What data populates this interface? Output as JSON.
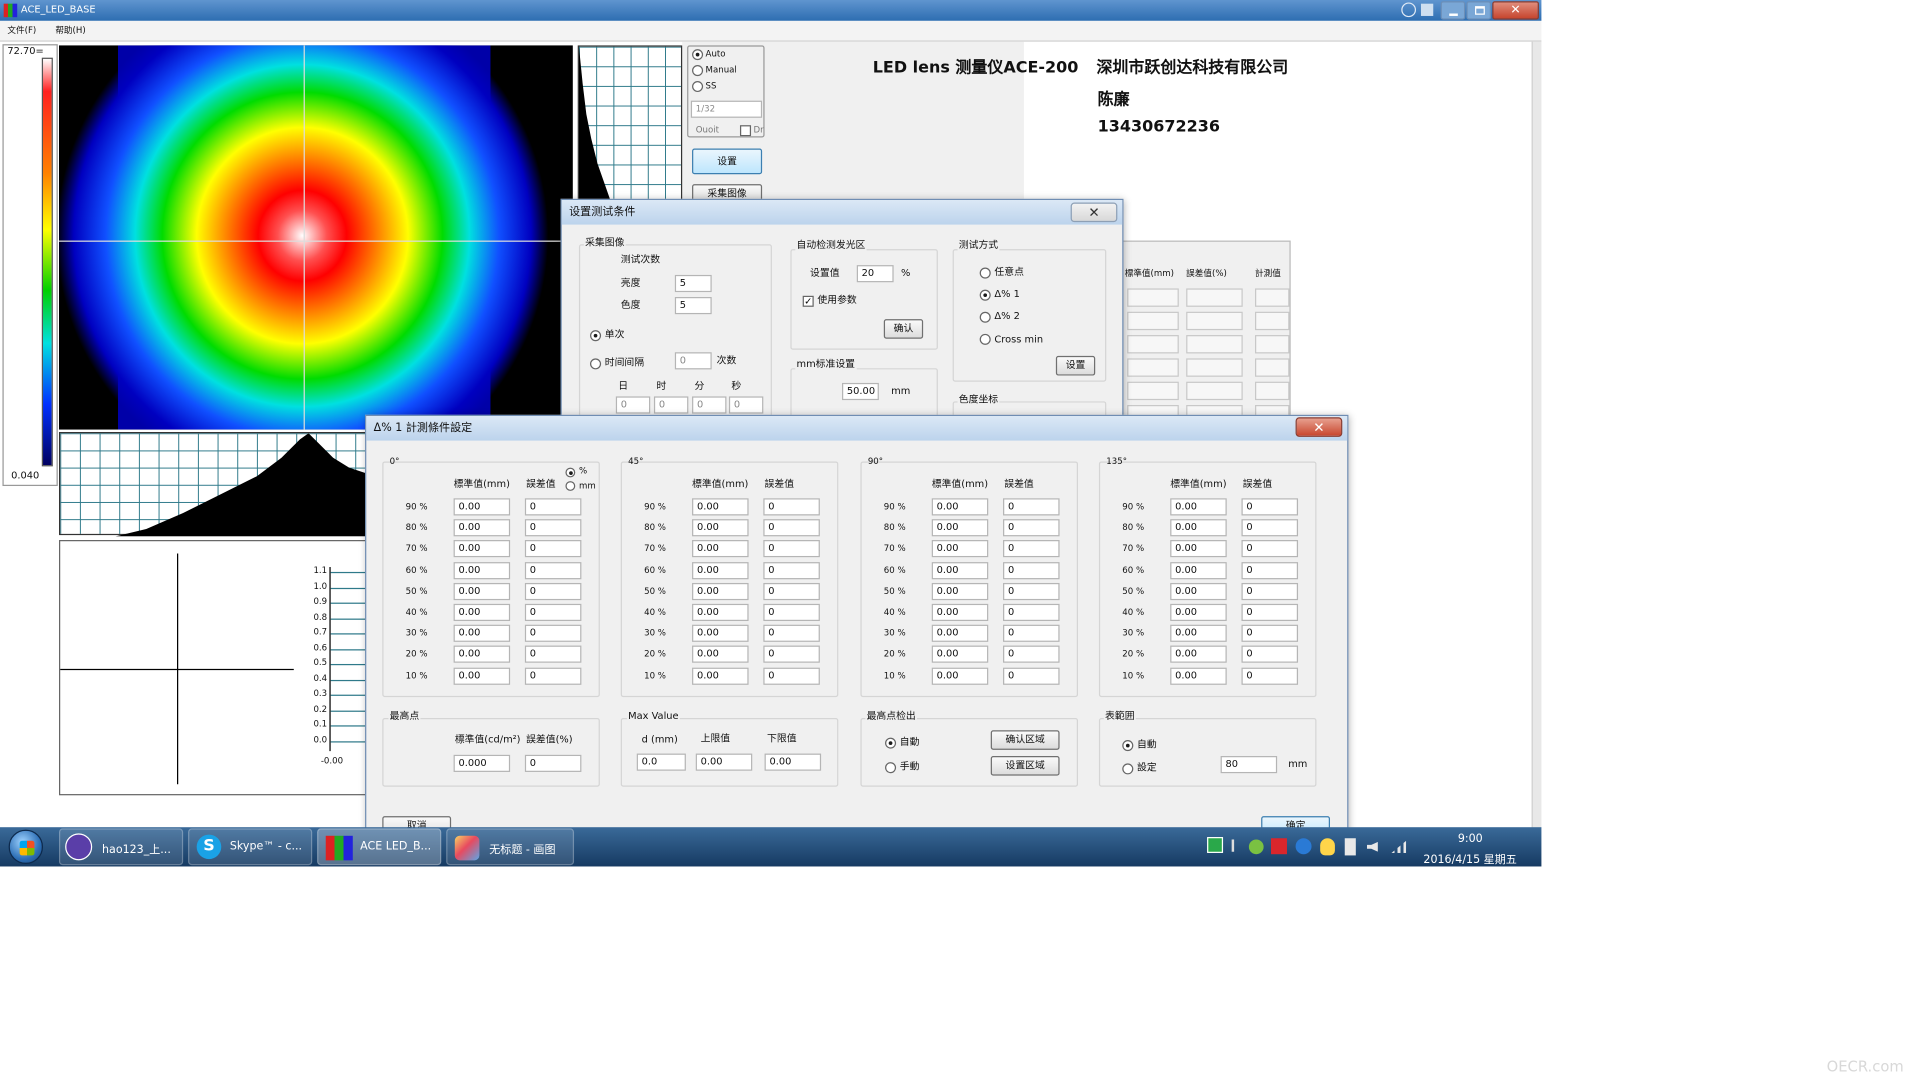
{
  "app": {
    "title": "ACE_LED_BASE",
    "menu": [
      "文件(F)",
      "帮助(H)"
    ]
  },
  "colorbar": {
    "max": "72.70=",
    "min": "0.040"
  },
  "lower_chart": {
    "ticks": [
      "1.1",
      "1.0",
      "0.9",
      "0.8",
      "0.7",
      "0.6",
      "0.5",
      "0.4",
      "0.3",
      "0.2",
      "0.1",
      "0.0",
      "-0.00"
    ]
  },
  "mode": {
    "options": [
      "Auto",
      "Manual",
      "SS"
    ],
    "selected": "Auto",
    "exposure": "1/32",
    "check_label": "Dr",
    "unit": "Ouoit",
    "settings_button": "设置",
    "capture_button": "采集图像"
  },
  "overlay": {
    "line1": "LED lens 测量仪ACE-200",
    "company": "深圳市跃创达科技有限公司",
    "contact": "陈廉",
    "phone": "13430672236"
  },
  "bg_table": {
    "headers": [
      "標準值(mm)",
      "誤差值(%)",
      "計測值"
    ]
  },
  "test_dialog": {
    "title": "设置测试条件",
    "capture": {
      "group": "采集图像",
      "count_label": "测试次数",
      "brightness_label": "亮度",
      "brightness": "5",
      "color_label": "色度",
      "color": "5",
      "single": "单次",
      "interval": "时间间隔",
      "interval_value": "0",
      "times": "次数",
      "units": [
        "日",
        "时",
        "分",
        "秒"
      ],
      "unit_values": [
        "0",
        "0",
        "0",
        "0"
      ]
    },
    "auto": {
      "group": "自动检测发光区",
      "set_label": "设置值",
      "set_value": "20",
      "pct": "%",
      "use_params": "使用参数",
      "confirm": "确认"
    },
    "mm": {
      "group": "mm标准设置",
      "value": "50.00",
      "unit": "mm"
    },
    "method": {
      "group": "测试方式",
      "options": [
        "任意点",
        "Δ% 1",
        "Δ% 2",
        "Cross min"
      ],
      "selected": "Δ% 1",
      "set_button": "设置"
    },
    "coord": {
      "group": "色度坐标"
    }
  },
  "delta_dialog": {
    "title": "Δ% 1 計測條件設定",
    "pct_levels": [
      "90 %",
      "80 %",
      "70 %",
      "60 %",
      "50 %",
      "40 %",
      "30 %",
      "20 %",
      "10 %"
    ],
    "unit_options": [
      "%",
      "mm"
    ],
    "unit_selected": "%",
    "panels": [
      {
        "angle": "0°",
        "std_header": "標準值(mm)",
        "err_header": "誤差值",
        "std": [
          "0.00",
          "0.00",
          "0.00",
          "0.00",
          "0.00",
          "0.00",
          "0.00",
          "0.00",
          "0.00"
        ],
        "err": [
          "0",
          "0",
          "0",
          "0",
          "0",
          "0",
          "0",
          "0",
          "0"
        ]
      },
      {
        "angle": "45°",
        "std_header": "標準值(mm)",
        "err_header": "誤差值",
        "std": [
          "0.00",
          "0.00",
          "0.00",
          "0.00",
          "0.00",
          "0.00",
          "0.00",
          "0.00",
          "0.00"
        ],
        "err": [
          "0",
          "0",
          "0",
          "0",
          "0",
          "0",
          "0",
          "0",
          "0"
        ]
      },
      {
        "angle": "90°",
        "std_header": "標準值(mm)",
        "err_header": "誤差值",
        "std": [
          "0.00",
          "0.00",
          "0.00",
          "0.00",
          "0.00",
          "0.00",
          "0.00",
          "0.00",
          "0.00"
        ],
        "err": [
          "0",
          "0",
          "0",
          "0",
          "0",
          "0",
          "0",
          "0",
          "0"
        ]
      },
      {
        "angle": "135°",
        "std_header": "標準值(mm)",
        "err_header": "誤差值",
        "std": [
          "0.00",
          "0.00",
          "0.00",
          "0.00",
          "0.00",
          "0.00",
          "0.00",
          "0.00",
          "0.00"
        ],
        "err": [
          "0",
          "0",
          "0",
          "0",
          "0",
          "0",
          "0",
          "0",
          "0"
        ]
      }
    ],
    "peak": {
      "group": "最高点",
      "std_header": "標準值(cd/m²)",
      "err_header": "誤差值(%)",
      "std": "0.000",
      "err": "0"
    },
    "max_value": {
      "group": "Max Value",
      "d_label": "d (mm)",
      "upper_label": "上限值",
      "lower_label": "下限值",
      "d": "0.0",
      "upper": "0.00",
      "lower": "0.00"
    },
    "detect": {
      "group": "最高点检出",
      "options": [
        "自動",
        "手動"
      ],
      "selected": "自動",
      "confirm_area": "确认区域",
      "set_area": "设置区域"
    },
    "range": {
      "group": "表範囲",
      "options": [
        "自動",
        "設定"
      ],
      "selected": "自動",
      "value": "80",
      "unit": "mm"
    },
    "cancel": "取消",
    "ok": "确定"
  },
  "taskbar": {
    "items": [
      {
        "label": "hao123_上...",
        "icon": "crown-icon"
      },
      {
        "label": "Skype™ - c...",
        "icon": "skype-icon"
      },
      {
        "label": "ACE LED_B...",
        "icon": "ace-app-icon"
      },
      {
        "label": "无标题 - 画图",
        "icon": "paint-icon"
      }
    ],
    "time": "9:00",
    "date": "2016/4/15 星期五"
  },
  "watermark": "OECR.com",
  "colors": {
    "titlebar": "#2f6fb4",
    "taskbar": "#1c3f66",
    "grid": "#2f7a8a"
  }
}
